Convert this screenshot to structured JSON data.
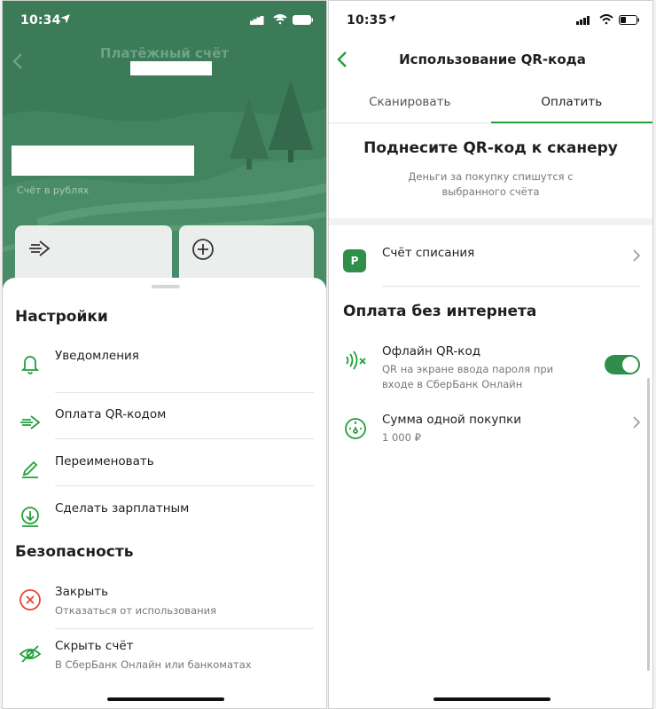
{
  "left": {
    "status_time": "10:34",
    "hero_title": "Платёжный счёт",
    "hero_subtitle": "Счёт в рублях",
    "settings_heading": "Настройки",
    "settings_items": [
      {
        "label": "Уведомления"
      },
      {
        "label": "Оплата QR-кодом"
      },
      {
        "label": "Переименовать"
      },
      {
        "label": "Сделать зарплатным"
      }
    ],
    "security_heading": "Безопасность",
    "security_items": [
      {
        "label": "Закрыть",
        "sub": "Отказаться от использования"
      },
      {
        "label": "Скрыть счёт",
        "sub": "В СберБанк Онлайн или банкоматах"
      }
    ]
  },
  "right": {
    "status_time": "10:35",
    "nav_title": "Использование QR-кода",
    "tabs": [
      {
        "label": "Сканировать",
        "active": false
      },
      {
        "label": "Оплатить",
        "active": true
      }
    ],
    "qr_title": "Поднесите QR-код к сканеру",
    "qr_subtitle": "Деньги за покупку спишутся с выбранного счёта",
    "debit_badge": "Р",
    "debit_label": "Счёт списания",
    "offline_heading": "Оплата без интернета",
    "offline_label": "Офлайн QR-код",
    "offline_sub": "QR на экране ввода пароля при входе в СберБанк Онлайн",
    "offline_enabled": true,
    "limit_label": "Сумма одной покупки",
    "limit_value": "1 000 ₽"
  },
  "colors": {
    "brand_green": "#21a038",
    "hero_green": "#3b7b58",
    "danger_red": "#e0463c"
  }
}
